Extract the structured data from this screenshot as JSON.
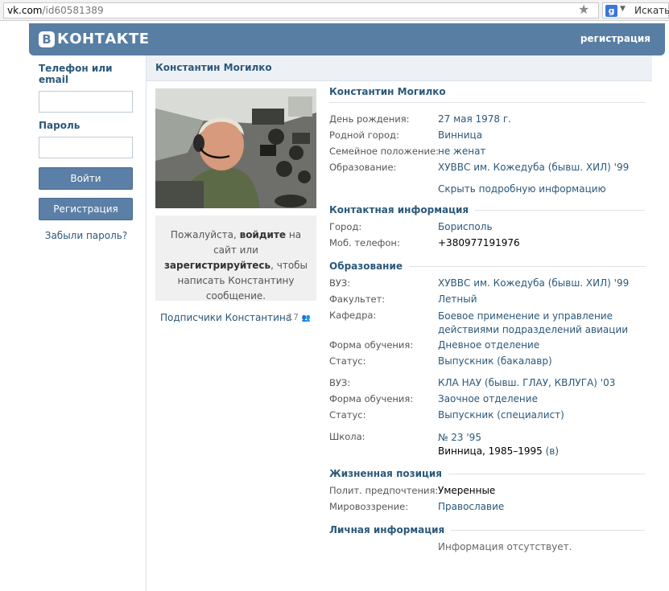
{
  "browser": {
    "url_domain": "vk.com",
    "url_path": "/id60581389",
    "search_text": "Искать"
  },
  "header": {
    "logo_letter": "В",
    "logo_text": "КОНТАКТЕ",
    "register_link": "регистрация"
  },
  "login": {
    "phone_label": "Телефон или email",
    "password_label": "Пароль",
    "login_button": "Войти",
    "register_button": "Регистрация",
    "forgot_link": "Забыли пароль?"
  },
  "profile": {
    "page_title": "Константин Могилко",
    "name": "Константин Могилко",
    "message_prompt": {
      "t1": "Пожалуйста, ",
      "b1": "войдите",
      "t2": " на сайт или ",
      "b2": "зарегистрируйтесь",
      "t3": ", чтобы написать Константину сообщение."
    },
    "subscribers_label": "Подписчики Константина",
    "subscribers_count": "17"
  },
  "basic": [
    {
      "key": "День рождения:",
      "value": "27 мая 1978 г."
    },
    {
      "key": "Родной город:",
      "value": "Винница"
    },
    {
      "key": "Семейное положение:",
      "value": "не женат"
    },
    {
      "key": "Образование:",
      "value": "ХУВВС им. Кожедуба (бывш. ХИЛ) '99"
    }
  ],
  "hide_info_link": "Скрыть подробную информацию",
  "contact": {
    "title": "Контактная информация",
    "rows": [
      {
        "key": "Город:",
        "value": "Борисполь"
      },
      {
        "key": "Моб. телефон:",
        "value": "+380977191976"
      }
    ]
  },
  "education": {
    "title": "Образование",
    "uni1": [
      {
        "key": "ВУЗ:",
        "value": "ХУВВС им. Кожедуба (бывш. ХИЛ) '99"
      },
      {
        "key": "Факультет:",
        "value": "Летный"
      },
      {
        "key": "Кафедра:",
        "value": "Боевое применение и управление",
        "value2": "действиями подразделений авиации"
      },
      {
        "key": "Форма обучения:",
        "value": "Дневное отделение"
      },
      {
        "key": "Статус:",
        "value": "Выпускник (бакалавр)"
      }
    ],
    "uni2": [
      {
        "key": "ВУЗ:",
        "value": "КЛА НАУ (бывш. ГЛАУ, КВЛУГА) '03"
      },
      {
        "key": "Форма обучения:",
        "value": "Заочное отделение"
      },
      {
        "key": "Статус:",
        "value": "Выпускник (специалист)"
      }
    ],
    "school": {
      "key": "Школа:",
      "value": "№ 23 '95",
      "detail": "Винница, 1985–1995",
      "detail_link": "(в)"
    }
  },
  "life": {
    "title": "Жизненная позиция",
    "rows": [
      {
        "key": "Полит. предпочтения:",
        "value": "Умеренные"
      },
      {
        "key": "Мировоззрение:",
        "value": "Православие"
      }
    ]
  },
  "personal": {
    "title": "Личная информация",
    "empty_text": "Информация отсутствует."
  },
  "colors": {
    "header_blue": "#587ea3",
    "link_blue": "#2b587a",
    "button_blue": "#5b7fa6"
  }
}
